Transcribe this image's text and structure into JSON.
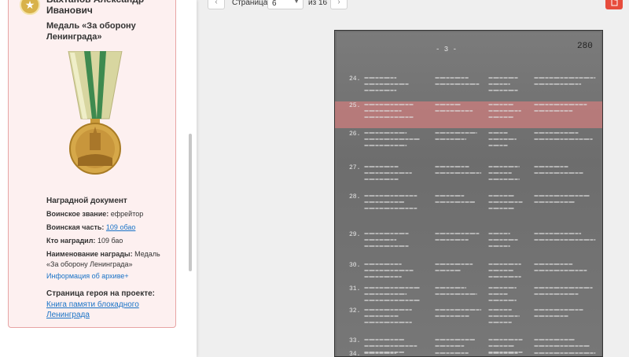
{
  "hero": {
    "name": "Вахтанов Александр Иванович",
    "award_title": "Медаль «За оборону Ленинграда»"
  },
  "document": {
    "heading": "Наградной документ",
    "rank_label": "Воинское звание:",
    "rank_value": "ефрейтор",
    "unit_label": "Воинская часть:",
    "unit_value": "109 обао",
    "awarded_by_label": "Кто наградил:",
    "awarded_by_value": "109 бао",
    "award_name_label": "Наименование награды:",
    "award_name_value": "Медаль «За оборону Ленинграда»",
    "archive_link": "Информация об архиве+"
  },
  "hero_page": {
    "heading": "Страница героя на проекте:",
    "link": "Книга памяти блокадного Ленинграда"
  },
  "pager": {
    "label": "Страница:",
    "current": "6",
    "total": "из 16"
  },
  "scan": {
    "page_marker": "- 3 -",
    "row_numbers": [
      "24.",
      "25.",
      "26.",
      "27.",
      "28.",
      "29.",
      "30.",
      "31.",
      "32.",
      "33.",
      "34."
    ]
  },
  "colors": {
    "card_border": "#e7a4a4",
    "link": "#1a73c7",
    "pdf_button": "#e74c3c",
    "highlight": "#ee8282"
  }
}
